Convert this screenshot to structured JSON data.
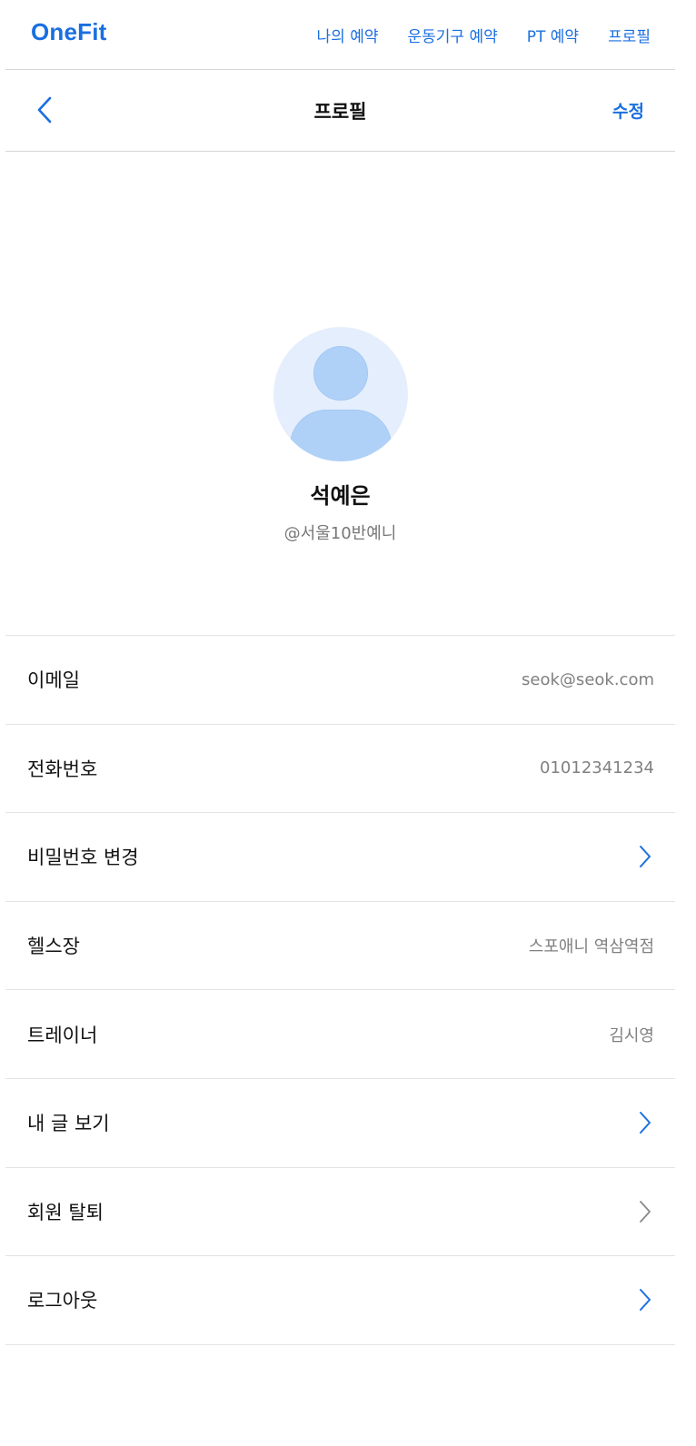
{
  "app": {
    "brand": "OneFit"
  },
  "nav": {
    "links": [
      "나의 예약",
      "운동기구 예약",
      "PT 예약",
      "프로필"
    ]
  },
  "header": {
    "title": "프로필",
    "edit_label": "수정",
    "back_icon": "chevron-left-icon"
  },
  "profile": {
    "name": "석예은",
    "handle": "@서울10반예니",
    "avatar_icon": "user-placeholder-icon"
  },
  "colors": {
    "accent": "#1a6fe0",
    "chevron_muted": "#8a8a8a",
    "avatar_bg": "#e5eefc",
    "avatar_fg": "#b0d1f7"
  },
  "rows": [
    {
      "label": "이메일",
      "value": "seok@seok.com"
    },
    {
      "label": "전화번호",
      "value": "01012341234"
    },
    {
      "label": "비밀번호 변경",
      "chevron": "accent"
    },
    {
      "label": "헬스장",
      "value": "스포애니 역삼역점"
    },
    {
      "label": "트레이너",
      "value": "김시영"
    },
    {
      "label": "내 글 보기",
      "chevron": "accent"
    },
    {
      "label": "회원 탈퇴",
      "chevron": "muted"
    },
    {
      "label": "로그아웃",
      "chevron": "accent"
    }
  ]
}
